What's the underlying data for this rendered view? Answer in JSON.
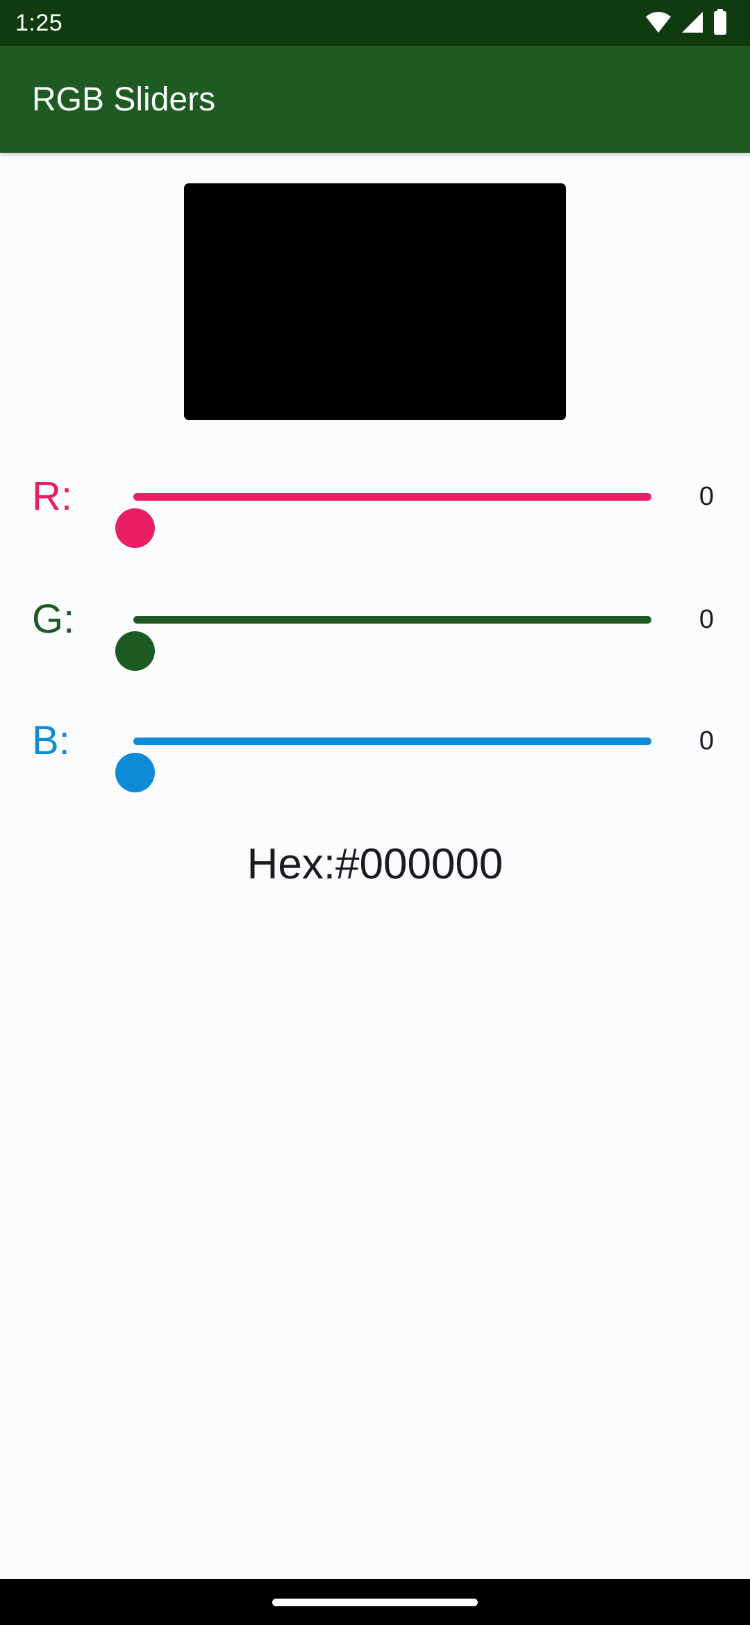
{
  "status_bar": {
    "time": "1:25",
    "icons": [
      "wifi-icon",
      "cellular-signal-icon",
      "battery-icon"
    ]
  },
  "app_bar": {
    "title": "RGB Sliders"
  },
  "colors": {
    "status_bar": "#0f3b0f",
    "app_bar": "#1e5b23",
    "red": "#e91e63",
    "green": "#1e5b23",
    "blue": "#0d8ad8",
    "preview": "#000000",
    "background": "#fbfcfe"
  },
  "preview": {
    "color": "#000000"
  },
  "sliders": [
    {
      "letter": "R:",
      "value": "0",
      "fraction": 0,
      "color": "#e91e63"
    },
    {
      "letter": "G:",
      "value": "0",
      "fraction": 0,
      "color": "#1e5b23"
    },
    {
      "letter": "B:",
      "value": "0",
      "fraction": 0,
      "color": "#0d8ad8"
    }
  ],
  "hex": {
    "text": "Hex:#000000"
  }
}
